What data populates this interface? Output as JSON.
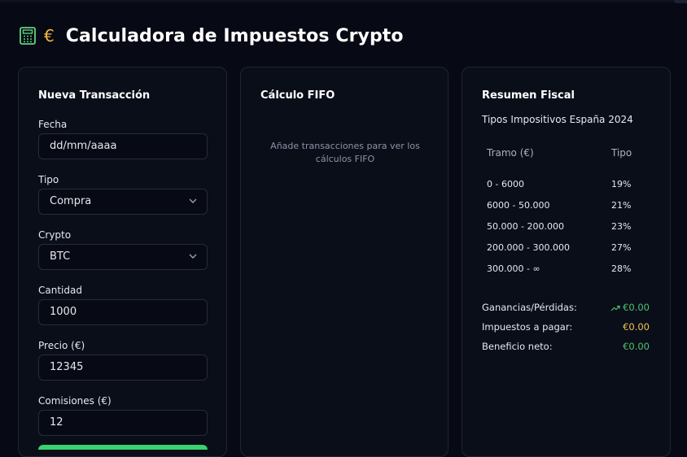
{
  "app": {
    "title": "Calculadora de Impuestos Crypto",
    "euro_symbol": "€",
    "accent_green": "#39d26e",
    "accent_amber": "#f5b841"
  },
  "new_transaction": {
    "title": "Nueva Transacción",
    "date": {
      "label": "Fecha",
      "placeholder": "dd/mm/aaaa"
    },
    "type": {
      "label": "Tipo",
      "value": "Compra"
    },
    "crypto": {
      "label": "Crypto",
      "value": "BTC"
    },
    "quantity": {
      "label": "Cantidad",
      "value": "1000"
    },
    "price": {
      "label": "Precio (€)",
      "value": "12345"
    },
    "fees": {
      "label": "Comisiones (€)",
      "value": "12"
    }
  },
  "fifo": {
    "title": "Cálculo FIFO",
    "empty_line1": "Añade transacciones para ver los",
    "empty_line2": "cálculos FIFO"
  },
  "summary": {
    "title": "Resumen Fiscal",
    "subtitle": "Tipos Impositivos España 2024",
    "table": {
      "headers": [
        "Tramo (€)",
        "Tipo"
      ],
      "rows": [
        [
          "0 - 6000",
          "19%"
        ],
        [
          "6000 - 50.000",
          "21%"
        ],
        [
          "50.000 - 200.000",
          "23%"
        ],
        [
          "200.000 - 300.000",
          "27%"
        ],
        [
          "300.000 - ∞",
          "28%"
        ]
      ]
    },
    "gains": {
      "label": "Ganancias/Pérdidas:",
      "value": "€0.00",
      "icon": "trending-up-icon"
    },
    "taxes": {
      "label": "Impuestos a pagar:",
      "value": "€0.00"
    },
    "net": {
      "label": "Beneficio neto:",
      "value": "€0.00"
    }
  }
}
